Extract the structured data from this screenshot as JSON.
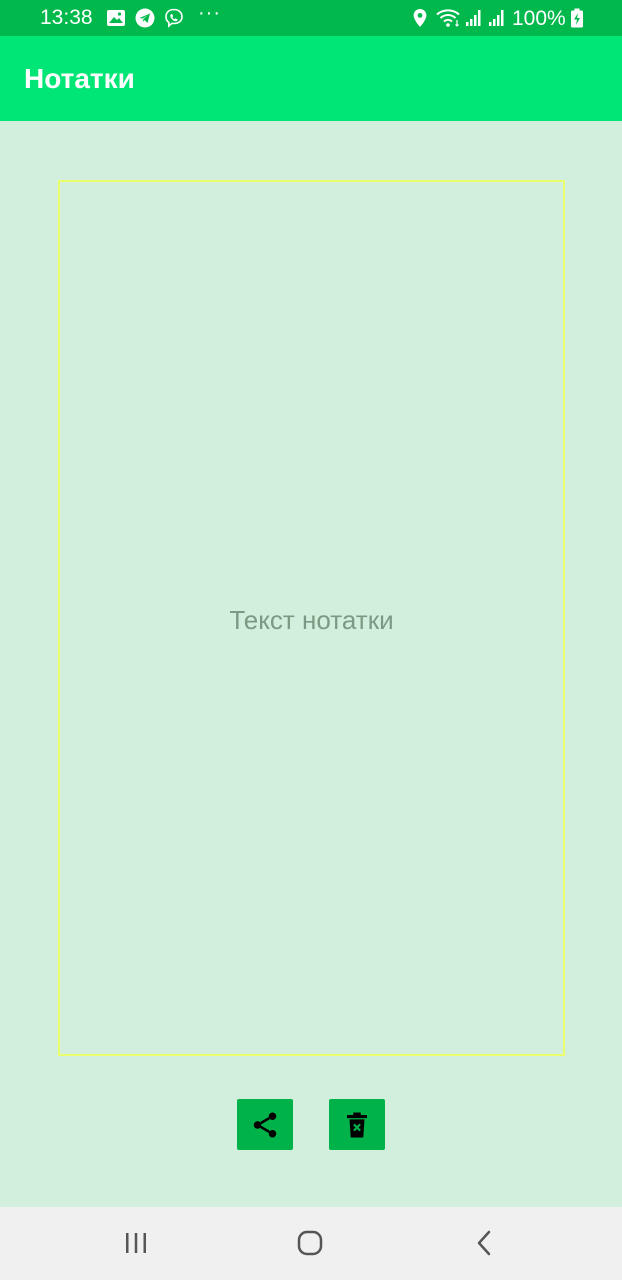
{
  "status_bar": {
    "time": "13:38",
    "battery_percent": "100%",
    "more_indicator": "···",
    "icons": [
      "gallery-icon",
      "telegram-icon",
      "viber-icon",
      "location-icon",
      "wifi-icon",
      "signal-icon",
      "signal-icon",
      "battery-charging-icon"
    ]
  },
  "app_bar": {
    "title": "Нотатки"
  },
  "note": {
    "placeholder": "Текст нотатки",
    "value": ""
  },
  "actions": {
    "share_icon": "share-icon",
    "delete_icon": "delete-icon"
  },
  "nav_bar": {
    "icons": [
      "recents-icon",
      "home-icon",
      "back-icon"
    ]
  },
  "colors": {
    "status_bar": "#00b84b",
    "app_bar": "#00e676",
    "background": "#d1efdc",
    "note_border": "#eaff6c",
    "button": "#00b24a",
    "nav_bar": "#f0f0f0"
  }
}
